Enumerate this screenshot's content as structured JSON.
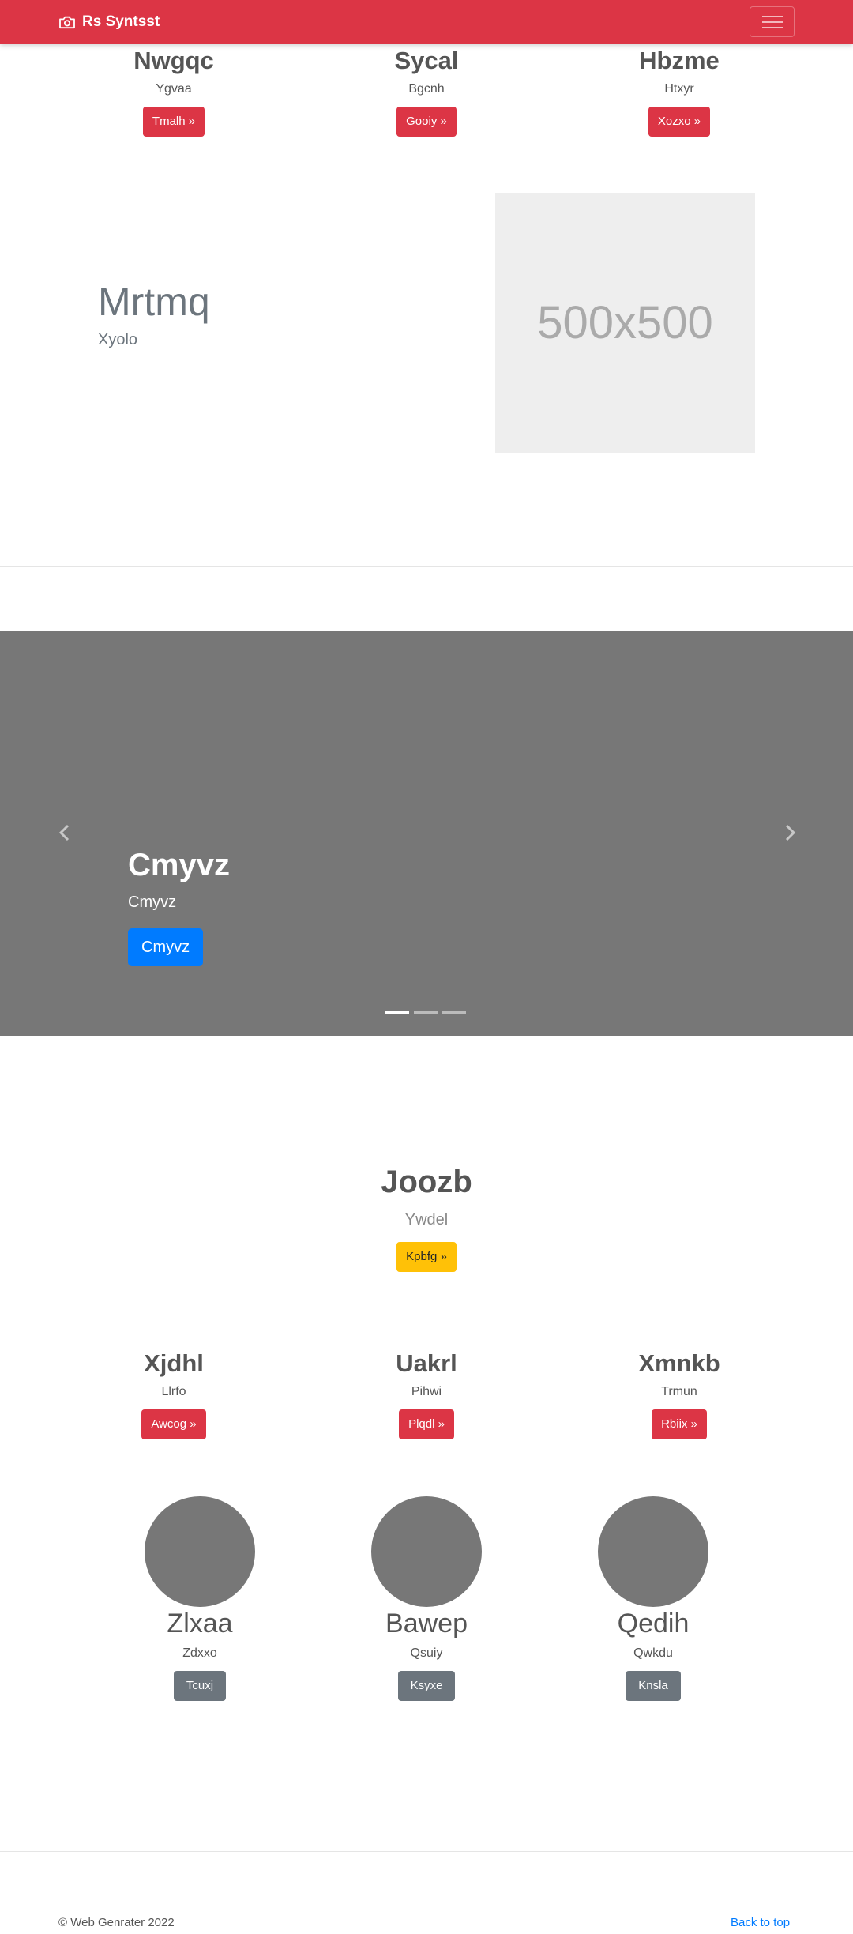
{
  "navbar": {
    "brand": "Rs Syntsst",
    "brand_icon": "camera-icon",
    "toggler_icon": "hamburger-icon"
  },
  "top_columns": [
    {
      "title": "Nwgqc",
      "text": "Ygvaa",
      "button": "Tmalh »"
    },
    {
      "title": "Sycal",
      "text": "Bgcnh",
      "button": "Gooiy »"
    },
    {
      "title": "Hbzme",
      "text": "Htxyr",
      "button": "Xozxo »"
    }
  ],
  "featurette": {
    "title": "Mrtmq",
    "subtitle": "Xyolo",
    "image_label": "500x500"
  },
  "carousel": {
    "caption_title": "Cmyvz",
    "caption_text": "Cmyvz",
    "caption_button": "Cmyvz",
    "prev_icon": "chevron-left-icon",
    "next_icon": "chevron-right-icon",
    "active_slide": 1,
    "slide_count": 3
  },
  "hero": {
    "title": "Joozb",
    "text": "Ywdel",
    "button": "Kpbfg »"
  },
  "mid_columns": [
    {
      "title": "Xjdhl",
      "text": "Llrfo",
      "button": "Awcog »"
    },
    {
      "title": "Uakrl",
      "text": "Pihwi",
      "button": "Plqdl »"
    },
    {
      "title": "Xmnkb",
      "text": "Trmun",
      "button": "Rbiix »"
    }
  ],
  "circle_columns": [
    {
      "title": "Zlxaa",
      "text": "Zdxxo",
      "button": "Tcuxj"
    },
    {
      "title": "Bawep",
      "text": "Qsuiy",
      "button": "Ksyxe"
    },
    {
      "title": "Qedih",
      "text": "Qwkdu",
      "button": "Knsla"
    }
  ],
  "footer": {
    "copyright": "© Web Genrater 2022",
    "back_to_top": "Back to top"
  },
  "colors": {
    "primary_red": "#dc3545",
    "blue": "#007bff",
    "yellow": "#ffc107",
    "gray": "#6c757d",
    "carousel_bg": "#777777"
  }
}
